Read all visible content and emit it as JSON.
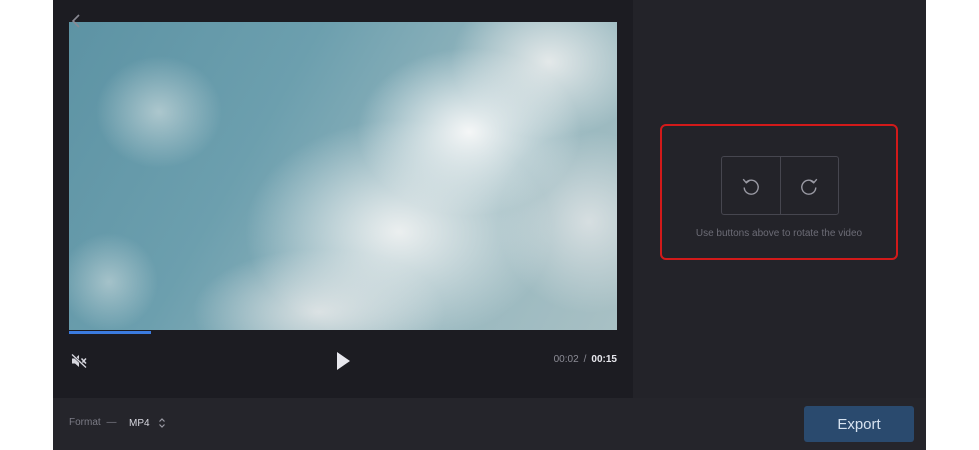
{
  "player": {
    "current_time": "00:02",
    "separator": "/",
    "total_time": "00:15",
    "progress_fraction": 0.15
  },
  "rotate": {
    "hint": "Use buttons above to rotate the video"
  },
  "footer": {
    "format_label": "Format",
    "format_dash": "—",
    "format_value": "MP4",
    "export_label": "Export"
  },
  "colors": {
    "accent": "#3b7be0",
    "highlight_border": "#d21a1a",
    "export_bg": "#2a4a6e"
  },
  "icons": {
    "back": "chevron-left-icon",
    "mute": "speaker-muted-icon",
    "play": "play-icon",
    "rotate_left": "rotate-ccw-icon",
    "rotate_right": "rotate-cw-icon",
    "format_toggle": "sort-arrows-icon"
  }
}
